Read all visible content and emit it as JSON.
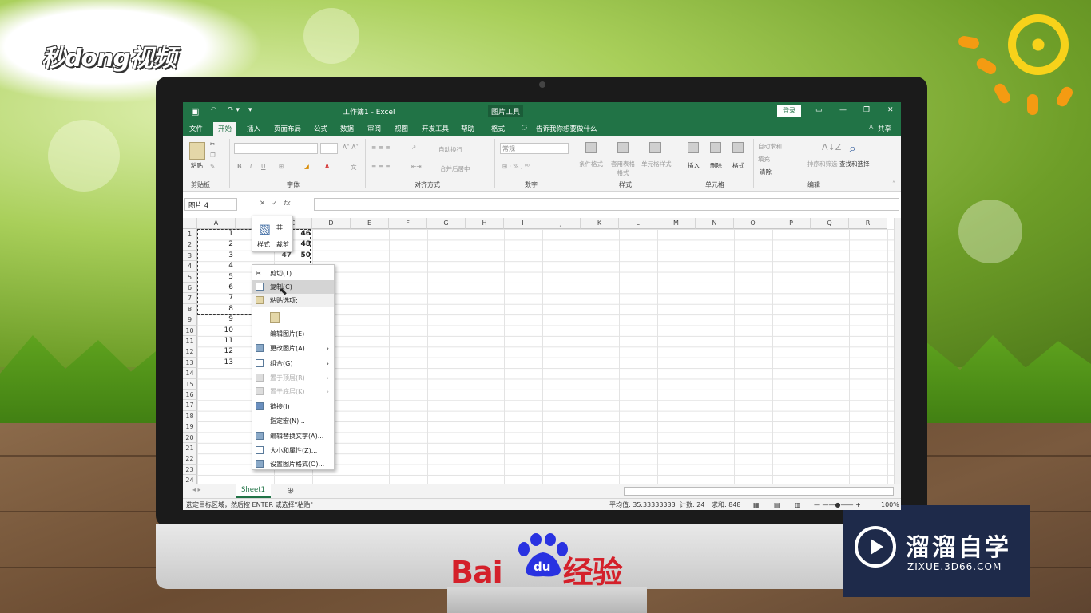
{
  "overlay": {
    "top_logo": "秒dong视频",
    "baidu_text": "Bai",
    "baidu_du": "du",
    "baidu_suffix": "经验",
    "zixue_title": "溜溜自学",
    "zixue_url": "ZIXUE.3D66.COM"
  },
  "excel": {
    "window_title": "工作簿1 - Excel",
    "context_tab": "图片工具",
    "login_label": "登录",
    "share_label": "共享",
    "tabs": [
      "文件",
      "开始",
      "插入",
      "页面布局",
      "公式",
      "数据",
      "审阅",
      "视图",
      "开发工具",
      "帮助",
      "格式"
    ],
    "active_tab": "开始",
    "tell_me": "告诉我你想要做什么",
    "ribbon_groups": [
      "剪贴板",
      "字体",
      "对齐方式",
      "数字",
      "样式",
      "单元格",
      "编辑"
    ],
    "ribbon_labels": {
      "paste": "粘贴",
      "wrap": "自动换行",
      "merge": "合并后居中",
      "number_format": "常规",
      "cond_format": "条件格式",
      "table_format": "套用表格格式",
      "cell_style": "单元格样式",
      "insert": "插入",
      "delete": "删除",
      "format": "格式",
      "autosum": "自动求和",
      "fill": "填充",
      "clear": "清除",
      "sort": "排序和筛选",
      "find": "查找和选择"
    },
    "name_box": "图片 4",
    "columns": [
      "A",
      "B",
      "C",
      "D",
      "E",
      "F",
      "G",
      "H",
      "I",
      "J",
      "K",
      "L",
      "M",
      "N",
      "O",
      "P",
      "Q",
      "R"
    ],
    "rows": [
      "1",
      "2",
      "3",
      "4",
      "5",
      "6",
      "7",
      "8",
      "9",
      "10",
      "11",
      "12",
      "13",
      "14",
      "15",
      "16",
      "17",
      "18",
      "19",
      "20",
      "21",
      "22",
      "23",
      "24"
    ],
    "col_a_values": [
      "1",
      "2",
      "3",
      "4",
      "5",
      "6",
      "7",
      "8",
      "9",
      "10",
      "11",
      "12",
      "13"
    ],
    "col_c_values": [
      "46",
      "48",
      "50"
    ],
    "b3_value": "47",
    "mini_toolbar": {
      "style": "样式",
      "crop": "裁剪"
    },
    "context_menu": [
      {
        "label": "剪切(T)",
        "icon": "scissors-icon",
        "state": "normal"
      },
      {
        "label": "复制(C)",
        "icon": "copy-icon",
        "state": "highlight"
      },
      {
        "label": "粘贴选项:",
        "icon": "paste-icon",
        "state": "header"
      },
      {
        "label": "",
        "icon": "paste-option-icon",
        "state": "option"
      },
      {
        "label": "编辑图片(E)",
        "icon": "",
        "state": "normal"
      },
      {
        "label": "更改图片(A)",
        "icon": "change-picture-icon",
        "state": "submenu"
      },
      {
        "label": "组合(G)",
        "icon": "group-icon",
        "state": "submenu"
      },
      {
        "label": "置于顶层(R)",
        "icon": "bring-front-icon",
        "state": "disabled-submenu"
      },
      {
        "label": "置于底层(K)",
        "icon": "send-back-icon",
        "state": "disabled-submenu"
      },
      {
        "label": "链接(I)",
        "icon": "link-icon",
        "state": "normal"
      },
      {
        "label": "指定宏(N)...",
        "icon": "",
        "state": "normal"
      },
      {
        "label": "编辑替换文字(A)...",
        "icon": "alt-text-icon",
        "state": "normal"
      },
      {
        "label": "大小和属性(Z)...",
        "icon": "size-icon",
        "state": "normal"
      },
      {
        "label": "设置图片格式(O)...",
        "icon": "format-picture-icon",
        "state": "normal"
      }
    ],
    "sheet_tab": "Sheet1",
    "status_left": "选定目标区域，然后按 ENTER 或选择\"粘贴\"",
    "status_avg": "平均值: 35.33333333",
    "status_count": "计数: 24",
    "status_sum": "求和: 848",
    "zoom": "100%"
  }
}
